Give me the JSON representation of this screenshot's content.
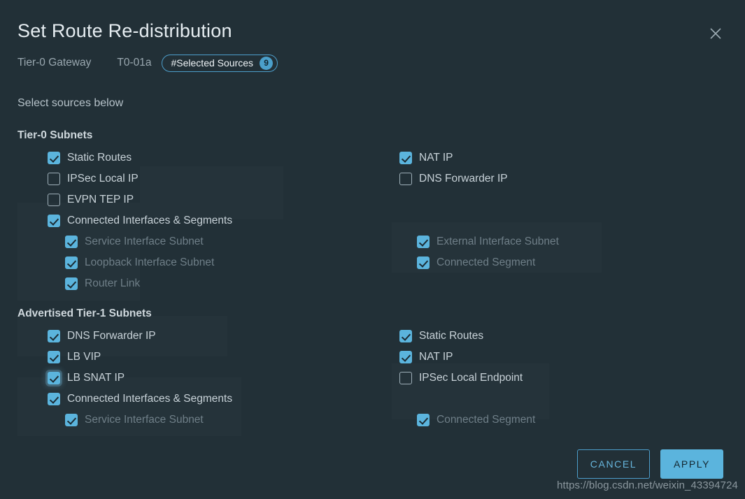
{
  "dialog": {
    "title": "Set Route Re-distribution",
    "close_icon": "close-icon",
    "meta": {
      "gateway_label": "Tier-0 Gateway",
      "gateway_value": "T0-01a",
      "pill_label": "#Selected Sources",
      "pill_count": "9"
    },
    "subtitle": "Select sources below"
  },
  "sections": [
    {
      "heading": "Tier-0 Subnets",
      "left": [
        {
          "label": "Static Routes",
          "checked": true,
          "disabled": false,
          "indent": 0,
          "focus": false
        },
        {
          "label": "IPSec Local IP",
          "checked": false,
          "disabled": false,
          "indent": 0,
          "focus": false
        },
        {
          "label": "EVPN TEP IP",
          "checked": false,
          "disabled": false,
          "indent": 0,
          "focus": false
        },
        {
          "label": "Connected Interfaces & Segments",
          "checked": true,
          "disabled": false,
          "indent": 0,
          "focus": false
        },
        {
          "label": "Service Interface Subnet",
          "checked": true,
          "disabled": true,
          "indent": 1,
          "focus": false
        },
        {
          "label": "Loopback Interface Subnet",
          "checked": true,
          "disabled": true,
          "indent": 1,
          "focus": false
        },
        {
          "label": "Router Link",
          "checked": true,
          "disabled": true,
          "indent": 1,
          "focus": false
        }
      ],
      "right": [
        {
          "label": "NAT IP",
          "checked": true,
          "disabled": false,
          "indent": 0,
          "focus": false
        },
        {
          "label": "DNS Forwarder IP",
          "checked": false,
          "disabled": false,
          "indent": 0,
          "focus": false
        },
        {
          "label": "External Interface Subnet",
          "checked": true,
          "disabled": true,
          "indent": 1,
          "focus": false
        },
        {
          "label": "Connected Segment",
          "checked": true,
          "disabled": true,
          "indent": 1,
          "focus": false
        }
      ]
    },
    {
      "heading": "Advertised Tier-1 Subnets",
      "left": [
        {
          "label": "DNS Forwarder IP",
          "checked": true,
          "disabled": false,
          "indent": 0,
          "focus": false
        },
        {
          "label": "LB VIP",
          "checked": true,
          "disabled": false,
          "indent": 0,
          "focus": false
        },
        {
          "label": "LB SNAT IP",
          "checked": true,
          "disabled": false,
          "indent": 0,
          "focus": true
        },
        {
          "label": "Connected Interfaces & Segments",
          "checked": true,
          "disabled": false,
          "indent": 0,
          "focus": false
        },
        {
          "label": "Service Interface Subnet",
          "checked": true,
          "disabled": true,
          "indent": 1,
          "focus": false
        }
      ],
      "right": [
        {
          "label": "Static Routes",
          "checked": true,
          "disabled": false,
          "indent": 0,
          "focus": false
        },
        {
          "label": "NAT IP",
          "checked": true,
          "disabled": false,
          "indent": 0,
          "focus": false
        },
        {
          "label": "IPSec Local Endpoint",
          "checked": false,
          "disabled": false,
          "indent": 0,
          "focus": false
        },
        {
          "label": "Connected Segment",
          "checked": true,
          "disabled": true,
          "indent": 1,
          "focus": false
        }
      ]
    }
  ],
  "footer": {
    "cancel_label": "CANCEL",
    "apply_label": "APPLY"
  },
  "watermark": "https://blog.csdn.net/weixin_43394724",
  "colors": {
    "background": "#223037",
    "accent": "#5bb4dd",
    "text": "#c8d2d8",
    "text_disabled": "#6f7f88"
  }
}
